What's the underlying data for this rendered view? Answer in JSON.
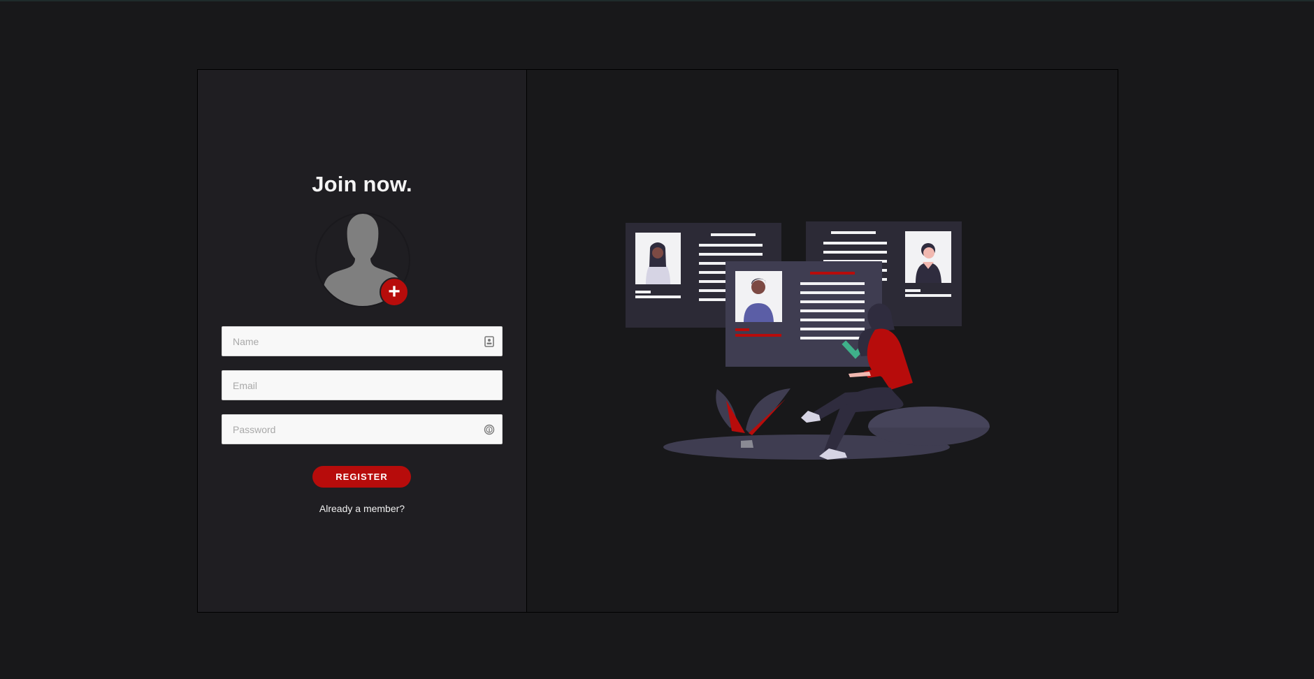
{
  "form": {
    "title": "Join now.",
    "name_placeholder": "Name",
    "email_placeholder": "Email",
    "password_placeholder": "Password",
    "register_label": "REGISTER",
    "member_link": "Already a member?",
    "add_icon": "+"
  },
  "icons": {
    "add_photo": "plus-icon",
    "name_field": "contact-card-icon",
    "password_field": "fingerprint-icon"
  },
  "colors": {
    "accent": "#b70c0b",
    "panel": "#1f1e22",
    "background": "#18181a",
    "check": "#3fb08a"
  }
}
